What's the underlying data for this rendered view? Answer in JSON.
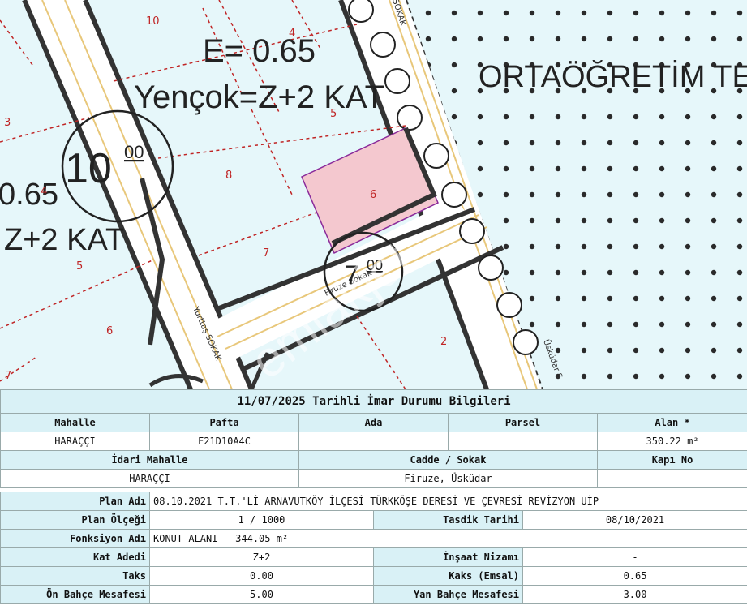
{
  "map": {
    "street_labels": [
      "Yurttaş SOKAK",
      "Firuze Sokak",
      "Üsküdar S",
      "SOKAK"
    ],
    "big_texts": [
      "E= 0.65",
      "Yençok=Z+2 KAT",
      "0.65",
      "Z+2 KAT",
      "ORTAÖĞRETİM TE"
    ],
    "elevation_1": {
      "main": "10",
      "sup": "00"
    },
    "elevation_2": {
      "main": "7",
      "sup": "00"
    },
    "parcel_numbers": [
      "10",
      "4",
      "3",
      "5",
      "4",
      "8",
      "6",
      "7",
      "5",
      "6",
      "7",
      "2"
    ],
    "watermark": "emlakjet",
    "colors": {
      "ground": "#e6f7fa",
      "road": "#ffffff",
      "road_edge": "#e8c77a",
      "block_line": "#3a3a3a",
      "parcel_line": "#c02525",
      "highlight": "#f4c8cf",
      "highlight_edge": "#8a2a9a"
    }
  },
  "report": {
    "title": "11/07/2025 Tarihli İmar Durumu Bilgileri",
    "row1_headers": [
      "Mahalle",
      "Pafta",
      "Ada",
      "Parsel",
      "Alan *"
    ],
    "row1_values": [
      "HARAÇÇI",
      "F21D10A4C",
      "",
      "",
      "350.22 m²"
    ],
    "row2_headers": [
      "İdari Mahalle",
      "Cadde / Sokak",
      "Kapı No"
    ],
    "row2_values": [
      "HARAÇÇI",
      "Firuze, Üsküdar",
      "-"
    ],
    "plan_adi_label": "Plan Adı",
    "plan_adi": "08.10.2021 T.T.'Lİ ARNAVUTKÖY İLÇESİ TÜRKKÖŞE DERESİ VE ÇEVRESİ REVİZYON UİP",
    "plan_olcegi_label": "Plan Ölçeği",
    "plan_olcegi": "1 / 1000",
    "tasdik_label": "Tasdik Tarihi",
    "tasdik": "08/10/2021",
    "fonksiyon_label": "Fonksiyon Adı",
    "fonksiyon": "KONUT ALANI - 344.05 m²",
    "kat_label": "Kat Adedi",
    "kat": "Z+2",
    "insaat_label": "İnşaat Nizamı",
    "insaat": "-",
    "taks_label": "Taks",
    "taks": "0.00",
    "kaks_label": "Kaks (Emsal)",
    "kaks": "0.65",
    "on_bahce_label": "Ön Bahçe Mesafesi",
    "on_bahce": "5.00",
    "yan_bahce_label": "Yan Bahçe Mesafesi",
    "yan_bahce": "3.00"
  }
}
